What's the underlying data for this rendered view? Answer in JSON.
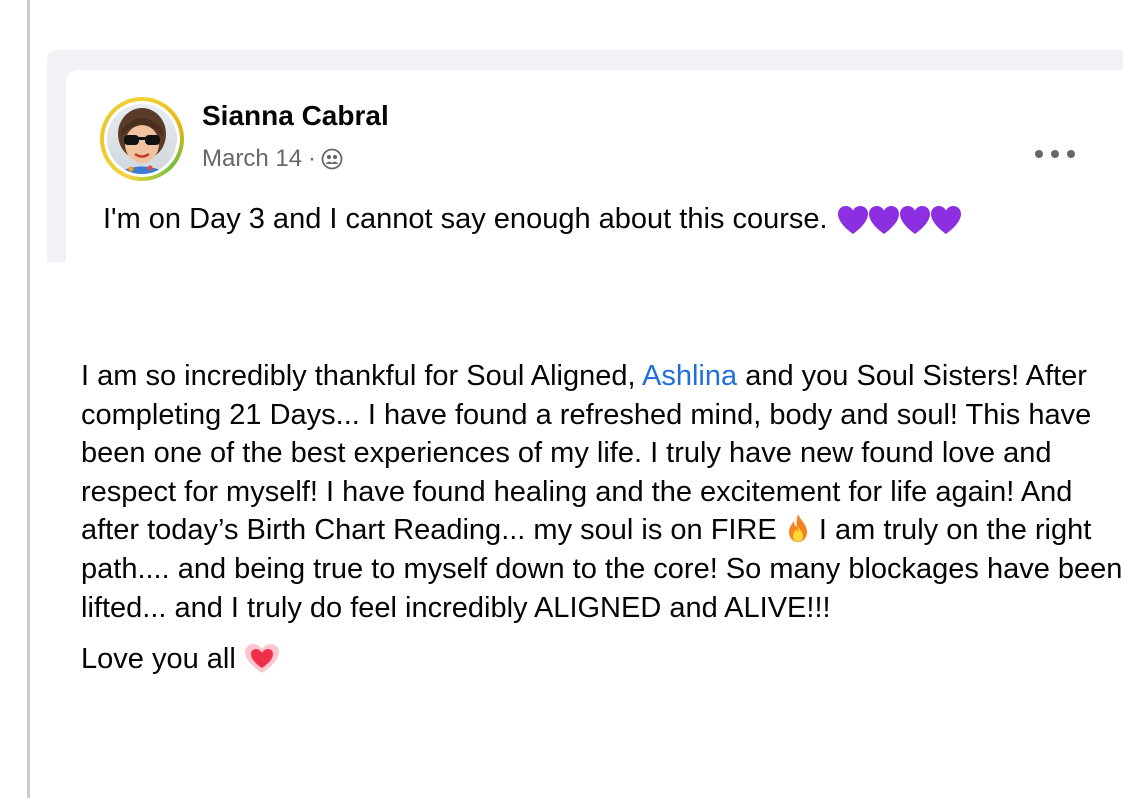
{
  "post": {
    "author": "Sianna Cabral",
    "date": "March 14",
    "separator": "·",
    "privacy_icon": "group-audience-icon",
    "more_icon": "more-options-icon",
    "text": "I'm on Day 3 and I cannot say enough about this course.",
    "emoji": [
      "purple-heart",
      "purple-heart",
      "purple-heart",
      "purple-heart"
    ],
    "colors": {
      "card_bg": "#f0f2f5",
      "meta": "#65676b",
      "purple_heart": "#8b2fe0",
      "avatar_ring": "#f4d23a"
    }
  },
  "review": {
    "part1": "I am so incredibly thankful for Soul Aligned,",
    "mention": "Ashlina",
    "part2": "and you Soul Sisters! After completing 21 Days... I have found a refreshed mind, body and soul! This have been one of the best experiences of my life. I truly have new found love and respect for myself! I have found healing and the excitement for life again! And after today’s Birth Chart Reading... my soul is on FIRE",
    "fire_icon": "fire-emoji",
    "part3": "I am truly on the right path.... and being true to myself down to the core! So many blockages have been lifted... and I truly do feel incredibly ALIGNED and ALIVE!!!",
    "closing": "Love you all",
    "closing_icon": "heart-emoji",
    "colors": {
      "mention": "#216fdb"
    }
  }
}
